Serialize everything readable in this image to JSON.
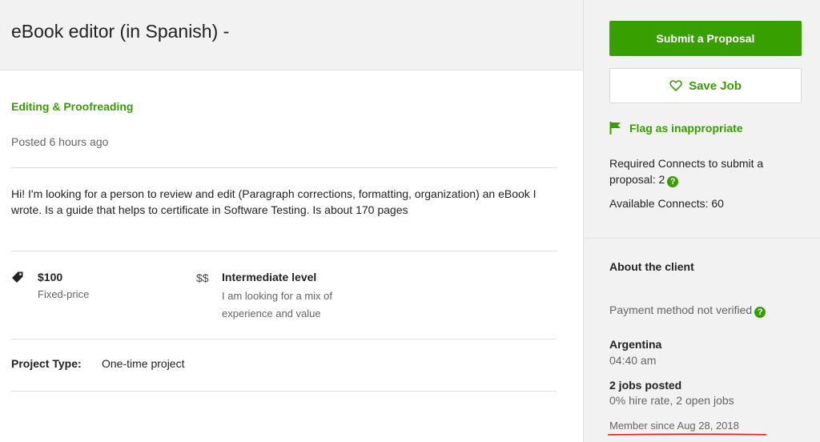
{
  "job": {
    "title": "eBook editor (in Spanish) -",
    "category": "Editing & Proofreading",
    "posted": "Posted 6 hours ago",
    "description": "Hi! I'm looking for a person to review and edit (Paragraph corrections, formatting, organization) an eBook I wrote. Is a guide that helps to certificate in Software Testing. Is about 170 pages",
    "price": "$100",
    "price_type": "Fixed-price",
    "level_symbol": "$$",
    "level": "Intermediate level",
    "level_desc": "I am looking for a mix of experience and value",
    "project_type_label": "Project Type:",
    "project_type": "One-time project"
  },
  "sidebar": {
    "submit_label": "Submit a Proposal",
    "save_label": "Save Job",
    "flag_label": "Flag as inappropriate",
    "connects_required": "Required Connects to submit a proposal: 2",
    "connects_available": "Available Connects: 60",
    "help_glyph": "?"
  },
  "client": {
    "heading": "About the client",
    "payment": "Payment method not verified",
    "country": "Argentina",
    "local_time": "04:40 am",
    "jobs_posted": "2 jobs posted",
    "hire_info": "0% hire rate, 2 open jobs",
    "member_since": "Member since Aug 28, 2018"
  },
  "colors": {
    "brand_green": "#37a000",
    "annotation_red": "#e0201c"
  },
  "icons": {
    "price": "price-tag-icon",
    "save": "heart-icon",
    "flag": "flag-icon",
    "help": "question-circle-icon"
  }
}
